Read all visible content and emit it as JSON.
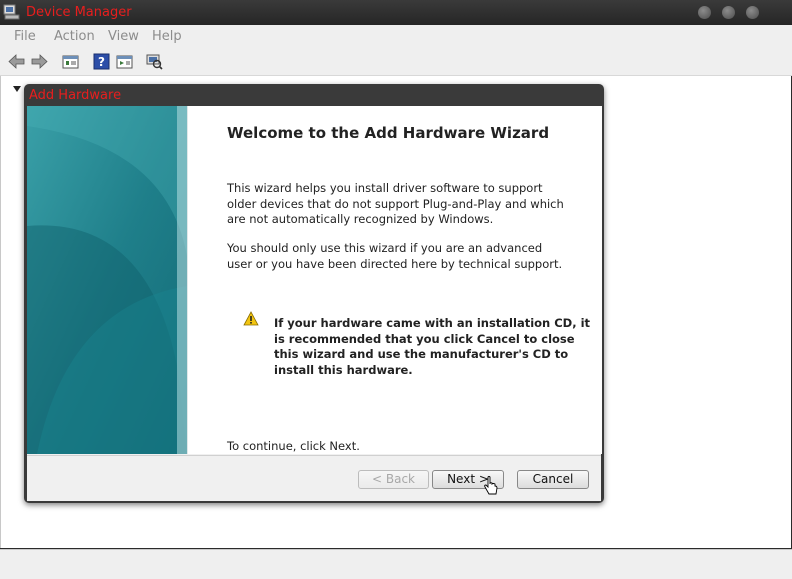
{
  "window": {
    "title": "Device Manager",
    "title_color": "#e81e1e"
  },
  "menu": {
    "items": [
      "File",
      "Action",
      "View",
      "Help"
    ]
  },
  "toolbar": {
    "icons": [
      "back-arrow-icon",
      "forward-arrow-icon",
      "properties-icon",
      "help-icon",
      "show-hide-pane-icon",
      "scan-hardware-icon"
    ]
  },
  "dialog": {
    "title": "Add Hardware",
    "heading": "Welcome to the Add Hardware Wizard",
    "paragraph1": "This wizard helps you install driver software to support older devices that do not support Plug-and-Play and which are not automatically recognized by Windows.",
    "paragraph2": "You should only use this wizard if you are an advanced user or you have been directed here by technical support.",
    "warning": "If your hardware came with an installation CD, it is recommended that you click Cancel to close this wizard and use the manufacturer's CD to install this hardware.",
    "continue_text": "To continue, click Next.",
    "buttons": {
      "back": "< Back",
      "next": "Next >",
      "cancel": "Cancel"
    },
    "banner_color": "#20808c"
  }
}
